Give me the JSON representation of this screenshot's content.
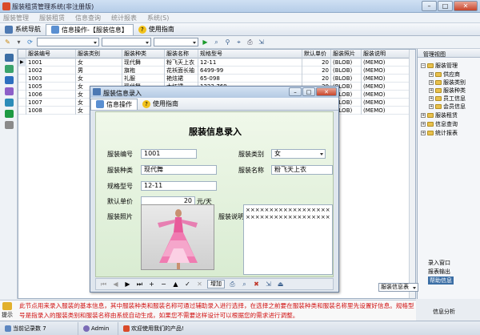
{
  "window": {
    "title": "服装租赁管理系统(非注册版)"
  },
  "menu": [
    "服装管理",
    "服装租赁",
    "信息查询",
    "统计报表",
    "系统(S)"
  ],
  "tabs": [
    {
      "label": "系统导航"
    },
    {
      "label": "信息操作-【服装信息】"
    },
    {
      "label": "使用指南"
    }
  ],
  "grid": {
    "headers": [
      "服装编号",
      "服装类别",
      "服装种类",
      "服装名称",
      "规格型号",
      "默认单价",
      "服装照片",
      "服装说明"
    ],
    "rows": [
      [
        "1001",
        "女",
        "现代舞",
        "粉飞天上衣",
        "12-11",
        "20",
        "(BLOB)",
        "(MEMO)"
      ],
      [
        "1002",
        "男",
        "旗袍",
        "花袄面长袖",
        "6499-99",
        "20",
        "(BLOB)",
        "(MEMO)"
      ],
      [
        "1003",
        "女",
        "礼服",
        "艳炫裙",
        "65-098",
        "20",
        "(BLOB)",
        "(MEMO)"
      ],
      [
        "1005",
        "女",
        "现代舞",
        "大红裙",
        "1223-769",
        "20",
        "(BLOB)",
        "(MEMO)"
      ],
      [
        "1006",
        "女",
        "",
        "",
        "",
        "",
        "(BLOB)",
        "(MEMO)"
      ],
      [
        "1007",
        "女",
        "",
        "",
        "",
        "",
        "(BLOB)",
        "(MEMO)"
      ],
      [
        "1008",
        "女",
        "",
        "",
        "",
        "",
        "(BLOB)",
        "(MEMO)"
      ]
    ]
  },
  "tree": {
    "header": "管理视图",
    "items": [
      "服装管理",
      "供应商",
      "服装类别",
      "服装种类",
      "员工信息",
      "会员信息",
      "服装租赁",
      "信息查询",
      "统计报表"
    ],
    "buttons": [
      "录入窗口",
      "报表输出",
      "帮助信息",
      "信息分析"
    ]
  },
  "dialog": {
    "title": "服装信息录入",
    "tabs": [
      "信息操作",
      "使用指南"
    ],
    "heading": "服装信息录入",
    "fields": {
      "code_label": "服装编号",
      "code": "1001",
      "category_label": "服装类别",
      "category": "女",
      "kind_label": "服装种类",
      "kind": "现代舞",
      "name_label": "服装名称",
      "name": "粉飞天上衣",
      "spec_label": "规格型号",
      "spec": "12-11",
      "price_label": "默认单价",
      "price": "20",
      "price_unit": "元/天",
      "photo_label": "服装照片",
      "memo_label": "服装说明",
      "memo": "××××××××××××××××××××××××××××××××××××"
    },
    "nav": {
      "add": "增加"
    }
  },
  "combo": {
    "label": "服装信息表"
  },
  "hint": {
    "label": "提示",
    "text": "此节点用来录入服装的基本信息，其中服装种类和服装名称可通过辅助录入进行选择，在选择之前要在服装种类和服装名称里先设置好信息。规格型号是指录入的服装类别和服装名称由系统自动生成，如果您不需要这样设计可以根据您的需求进行调整。"
  },
  "status": {
    "login": "当前记录数 7",
    "user": "Admin",
    "welcome": "欢迎使用我们的产品!"
  },
  "colors": {
    "accent": "#3b6ea5",
    "hint_red": "#d01010",
    "form_green": "#dff0d6"
  }
}
